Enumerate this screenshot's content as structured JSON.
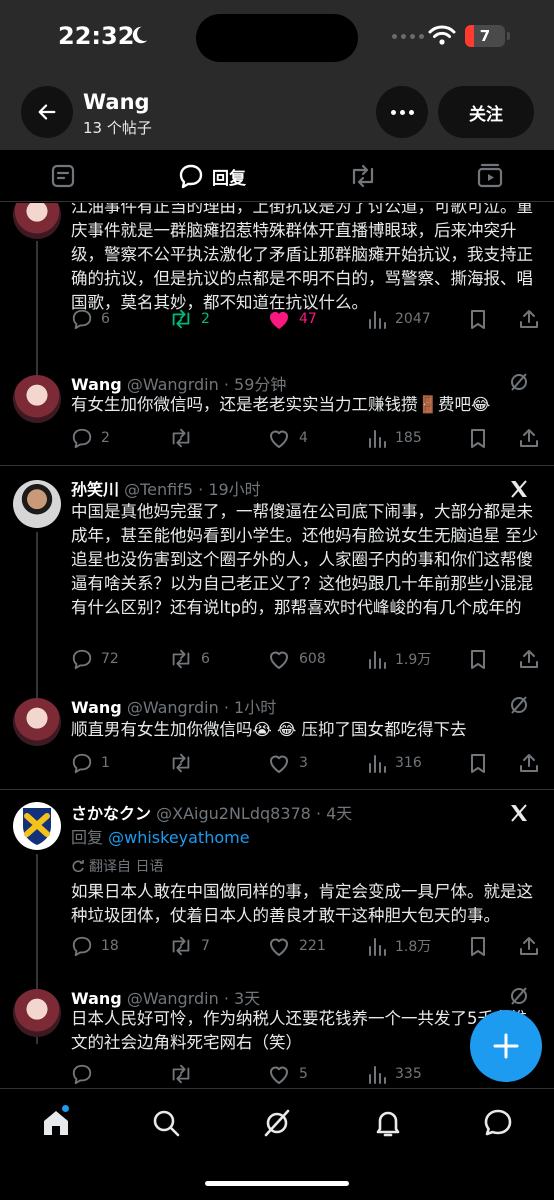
{
  "status": {
    "time": "22:32",
    "battery": "7"
  },
  "header": {
    "name": "Wang",
    "post_count": "13 个帖子",
    "follow_label": "关注"
  },
  "tabs": {
    "replies_label": "回复"
  },
  "tweets": [
    {
      "body": "江油事件有正当的理由，上街抗议是为了讨公道，可歌可泣。重庆事件就是一群脑瘫招惹特殊群体开直播博眼球，后来冲突升级，警察不公平执法激化了矛盾让那群脑瘫开始抗议，我支持正确的抗议，但是抗议的点都是不明不白的，骂警察、撕海报、唱国歌，莫名其妙，都不知道在抗议什么。",
      "replies": "6",
      "retweets": "2",
      "likes": "47",
      "views": "2047"
    },
    {
      "author": "Wang",
      "handle": "@Wangrdin",
      "time": "59分钟",
      "body": "有女生加你微信吗，还是老老实实当力工赚钱攒🚪费吧😂",
      "replies": "2",
      "retweets": "",
      "likes": "4",
      "views": "185"
    },
    {
      "author": "孙笑川",
      "handle": "@Tenfif5",
      "time": "19小时",
      "body": "中国是真他妈完蛋了，一帮傻逼在公司底下闹事，大部分都是未成年，甚至能他妈看到小学生。还他妈有脸说女生无脑追星 至少追星也没伤害到这个圈子外的人，人家圈子内的事和你们这帮傻逼有啥关系？以为自己老正义了？这他妈跟几十年前那些小混混有什么区别？还有说ltp的，那帮喜欢时代峰峻的有几个成年的",
      "replies": "72",
      "retweets": "6",
      "likes": "608",
      "views": "1.9万"
    },
    {
      "author": "Wang",
      "handle": "@Wangrdin",
      "time": "1小时",
      "body": "顺直男有女生加你微信吗😭 😂 压抑了国女都吃得下去",
      "replies": "1",
      "retweets": "",
      "likes": "3",
      "views": "316"
    },
    {
      "author": "さかなクン",
      "handle": "@XAigu2NLdq8378",
      "time": "4天",
      "reply_prefix": "回复",
      "reply_mention": "@whiskeyathome",
      "translated": "翻译自 日语",
      "body": "如果日本人敢在中国做同样的事，肯定会变成一具尸体。就是这种垃圾团体，仗着日本人的善良才敢干这种胆大包天的事。",
      "replies": "18",
      "retweets": "7",
      "likes": "221",
      "views": "1.8万"
    },
    {
      "author": "Wang",
      "handle": "@Wangrdin",
      "time": "3天",
      "body": "日本人民好可怜，作为纳税人还要花钱养一个一共发了5千条推文的社会边角料死宅网右（笑）",
      "replies": "",
      "retweets": "",
      "likes": "5",
      "views": "335"
    }
  ],
  "icons": {
    "moon": "moon-icon",
    "wifi": "wifi-icon",
    "back": "back-arrow-icon",
    "more": "more-icon",
    "reply": "reply-icon",
    "retweet": "retweet-icon",
    "like": "heart-icon",
    "views": "views-icon",
    "bookmark": "bookmark-icon",
    "share": "share-icon",
    "x_logo": "x-logo-icon",
    "grok": "grok-icon",
    "compose": "plus-icon",
    "home": "home-icon",
    "search": "search-icon",
    "notifications": "bell-icon",
    "messages": "message-icon"
  },
  "colors": {
    "accent": "#1d9bf0",
    "retweet_active": "#00ba7c",
    "like_active": "#f91880",
    "muted": "#71767b"
  }
}
